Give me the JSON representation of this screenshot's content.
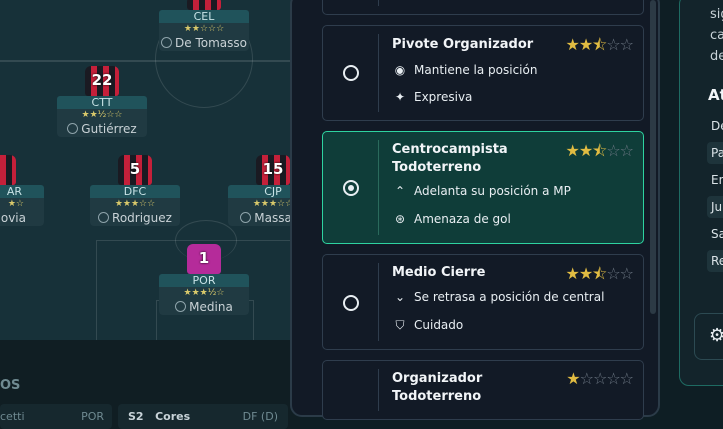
{
  "pitch": {
    "players": [
      {
        "pos": "CEL",
        "number": "",
        "stars": "★★☆☆☆",
        "name": "De Tomasso"
      },
      {
        "pos": "CTT",
        "number": "22",
        "stars": "★★½☆☆",
        "name": "Gutiérrez"
      },
      {
        "pos": "AR",
        "number": "",
        "stars": "★☆",
        "name": "ovia"
      },
      {
        "pos": "DFC",
        "number": "5",
        "stars": "★★★☆☆",
        "name": "Rodriguez"
      },
      {
        "pos": "CJP",
        "number": "15",
        "stars": "★★★☆☆",
        "name": "Massaco"
      },
      {
        "pos": "POR",
        "number": "1",
        "stars": "★★★½☆",
        "name": "Medina"
      }
    ]
  },
  "bottom": {
    "section_title": "OS",
    "rows": [
      {
        "name": "cetti",
        "pos": "POR"
      },
      {
        "slot": "S2",
        "name": "Cores",
        "pos": "DF (D)"
      }
    ]
  },
  "roles": [
    {
      "title": "Pivote Organizador",
      "stars": "★★⯪☆☆",
      "rating": 2.5,
      "selected": false,
      "attrs": [
        {
          "icon": "hold-position-icon",
          "label": "Mantiene la posición"
        },
        {
          "icon": "sparkle-icon",
          "label": "Expresiva"
        }
      ]
    },
    {
      "title": "Centrocampista Todoterreno",
      "stars": "★★⯪☆☆",
      "rating": 2.5,
      "selected": true,
      "attrs": [
        {
          "icon": "advance-icon",
          "label": "Adelanta su posición a MP"
        },
        {
          "icon": "goal-threat-icon",
          "label": "Amenaza de gol"
        }
      ]
    },
    {
      "title": "Medio Cierre",
      "stars": "★★⯪☆☆",
      "rating": 2.5,
      "selected": false,
      "attrs": [
        {
          "icon": "retreat-icon",
          "label": "Se retrasa a posición de central"
        },
        {
          "icon": "shield-icon",
          "label": "Cuidado"
        }
      ]
    },
    {
      "title": "Organizador Todoterreno",
      "stars": "★☆☆☆☆",
      "rating": 1,
      "selected": false,
      "attrs": []
    }
  ],
  "right_panel": {
    "lines": [
      "sig",
      "ca",
      "de"
    ],
    "heading": "At",
    "rows": [
      "De",
      "Pa",
      "En",
      "Ju",
      "Sa",
      "Re"
    ]
  }
}
